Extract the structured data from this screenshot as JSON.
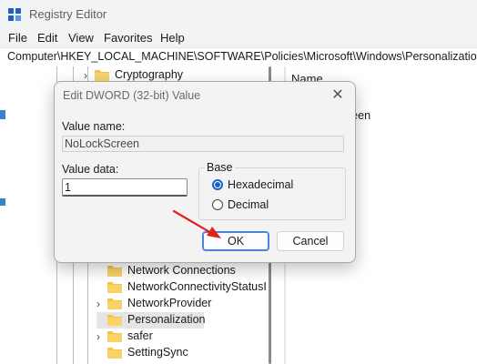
{
  "window": {
    "title": "Registry Editor"
  },
  "menu": [
    "File",
    "Edit",
    "View",
    "Favorites",
    "Help"
  ],
  "address": {
    "path": "Computer\\HKEY_LOCAL_MACHINE\\SOFTWARE\\Policies\\Microsoft\\Windows\\Personalization"
  },
  "tree": {
    "top_item": "Cryptography",
    "items": [
      {
        "label": "Network Connections",
        "expandable": false
      },
      {
        "label": "NetworkConnectivityStatusI",
        "expandable": false
      },
      {
        "label": "NetworkProvider",
        "expandable": true
      },
      {
        "label": "Personalization",
        "expandable": false,
        "selected": true
      },
      {
        "label": "safer",
        "expandable": true
      },
      {
        "label": "SettingSync",
        "expandable": false
      }
    ]
  },
  "values_pane": {
    "column_name": "Name",
    "visible_value": "reen"
  },
  "dialog": {
    "title": "Edit DWORD (32-bit) Value",
    "value_name_label": "Value name:",
    "value_name": "NoLockScreen",
    "value_data_label": "Value data:",
    "value_data": "1",
    "base_label": "Base",
    "base_options": [
      {
        "label": "Hexadecimal",
        "checked": true
      },
      {
        "label": "Decimal",
        "checked": false
      }
    ],
    "ok_label": "OK",
    "cancel_label": "Cancel"
  },
  "colors": {
    "accent": "#1a62c5",
    "annotation_arrow": "#e0231b",
    "folder": "#f5c24c"
  }
}
